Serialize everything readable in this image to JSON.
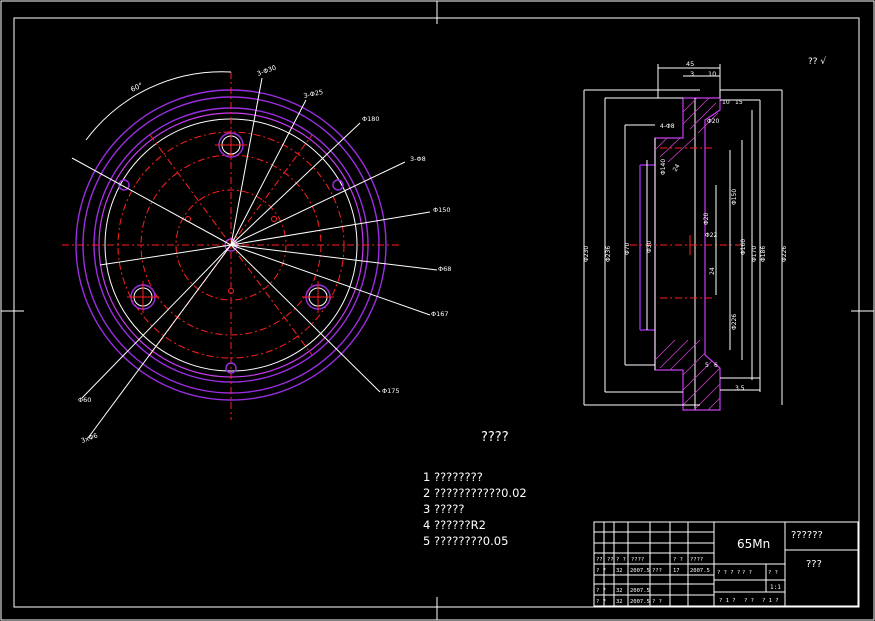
{
  "corner_marks": {
    "top_right": "??  √"
  },
  "front_view": {
    "arc_dim": "60°",
    "leaders": [
      "3-Φ30",
      "3-Φ25",
      "Φ180",
      "3-Φ8",
      "Φ150",
      "Φ68",
      "Φ167",
      "Φ175",
      "Φ60",
      "3xΦ6"
    ]
  },
  "side_view": {
    "top_dims": [
      "45",
      "3",
      "10"
    ],
    "left_dims": [
      "Φ230",
      "Φ236",
      "Φ70",
      "Φ30",
      "Φ140"
    ],
    "right_dims": [
      "Φ20",
      "Φ150",
      "Φ160",
      "Φ170",
      "Φ186",
      "Φ226",
      "Φ226"
    ],
    "mid_labels": [
      "Φ20",
      "Φ22",
      "3.5",
      "5",
      "6",
      "10",
      "15",
      "24",
      "24",
      "4-Φ8"
    ]
  },
  "notes": {
    "title": "????",
    "items": [
      "1 ????????",
      "2 ???????????0.02",
      "3 ?????",
      "4 ??????R2",
      "5 ????????0.05"
    ]
  },
  "title_block": {
    "material": "65Mn",
    "drawing_name": "??????",
    "drawing_no": "???",
    "row1": [
      "??",
      "??",
      "? ?",
      "????",
      "? ?",
      "????"
    ],
    "row2": [
      "? ?",
      "32",
      "2007.5",
      "???",
      "17",
      "2007.5"
    ],
    "row3": [
      "? ?",
      "32",
      "2007.5"
    ],
    "row4": [
      "? ?",
      "32",
      "2007.5",
      "? ?"
    ],
    "stage_labels": [
      "? ? ? ?",
      "? ?",
      "? ?"
    ],
    "scale": "1:1",
    "sheet": [
      "? 1 ?",
      "? ?",
      "? 1 ?"
    ]
  }
}
